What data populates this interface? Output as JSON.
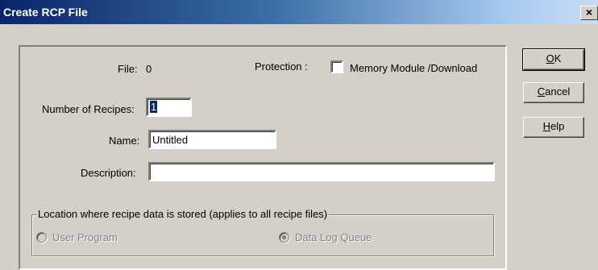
{
  "window": {
    "title": "Create RCP File",
    "close_glyph": "×"
  },
  "form": {
    "file_label": "File:",
    "file_value": "0",
    "protection_label": "Protection :",
    "memory_module_label": "Memory Module /Download",
    "memory_module_checked": false,
    "recipes_label": "Number of Recipes:",
    "recipes_value": "1",
    "name_label": "Name:",
    "name_value": "Untitled",
    "description_label": "Description:",
    "description_value": ""
  },
  "location_group": {
    "legend": "Location where recipe data is stored  (applies to all recipe files)",
    "options": [
      {
        "label": "User Program",
        "selected": false,
        "enabled": false
      },
      {
        "label": "Data Log Queue",
        "selected": true,
        "enabled": false
      }
    ]
  },
  "buttons": {
    "ok_mnemonic": "O",
    "ok_rest": "K",
    "cancel_mnemonic": "C",
    "cancel_rest": "ancel",
    "help_mnemonic": "H",
    "help_rest": "elp"
  }
}
